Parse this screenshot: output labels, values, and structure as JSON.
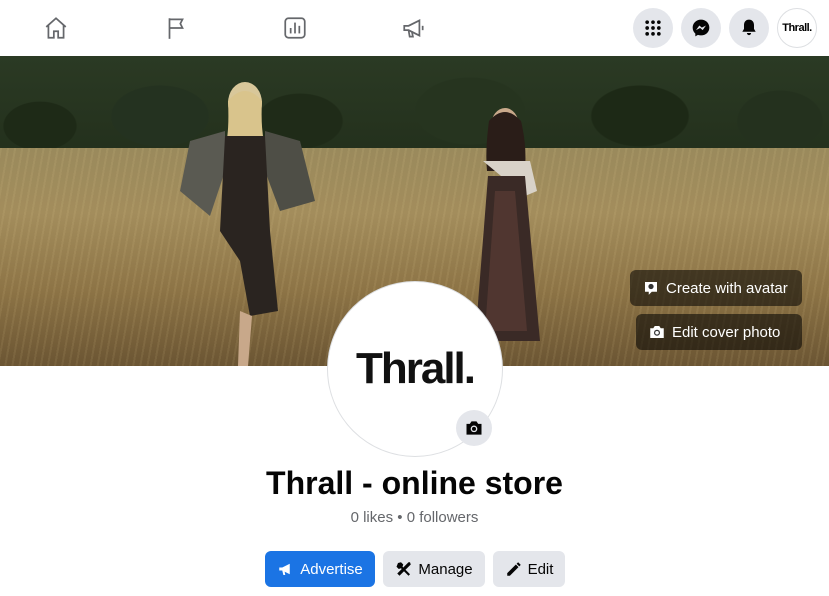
{
  "topnav": {
    "tabs": [
      {
        "icon": "home-icon"
      },
      {
        "icon": "flag-icon"
      },
      {
        "icon": "insights-icon"
      },
      {
        "icon": "megaphone-icon"
      }
    ],
    "profile_label": "Thrall."
  },
  "cover": {
    "create_avatar_label": "Create with avatar",
    "edit_cover_label": "Edit cover photo"
  },
  "avatar": {
    "logo_text": "Thrall."
  },
  "page": {
    "name": "Thrall - online store",
    "stats": "0 likes • 0 followers"
  },
  "actions": {
    "advertise_label": "Advertise",
    "manage_label": "Manage",
    "edit_label": "Edit"
  },
  "colors": {
    "primary": "#1b74e4",
    "secondary_bg": "#e4e6eb",
    "muted_text": "#65676b"
  }
}
